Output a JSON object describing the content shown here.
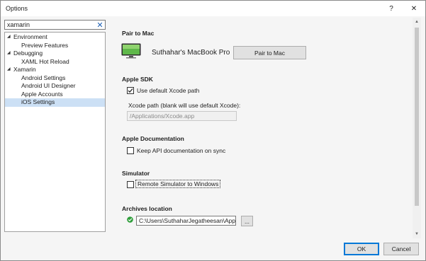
{
  "window": {
    "title": "Options",
    "help_label": "?",
    "close_label": "✕"
  },
  "search": {
    "value": "xamarin",
    "clear_label": "✕"
  },
  "tree": [
    {
      "label": "Environment",
      "expanded": true,
      "level": 0
    },
    {
      "label": "Preview Features",
      "level": 1
    },
    {
      "label": "Debugging",
      "expanded": true,
      "level": 0
    },
    {
      "label": "XAML Hot Reload",
      "level": 1
    },
    {
      "label": "Xamarin",
      "expanded": true,
      "level": 0
    },
    {
      "label": "Android Settings",
      "level": 1
    },
    {
      "label": "Android UI Designer",
      "level": 1
    },
    {
      "label": "Apple Accounts",
      "level": 1
    },
    {
      "label": "iOS Settings",
      "level": 1,
      "selected": true
    }
  ],
  "pair": {
    "title": "Pair to Mac",
    "mac_name": "Suthahar's MacBook Pro",
    "button_label": "Pair to Mac"
  },
  "sdk": {
    "title": "Apple SDK",
    "use_default_label": "Use default Xcode path",
    "use_default_checked": true,
    "xcode_path_label": "Xcode path (blank will use default Xcode):",
    "xcode_path_value": "/Applications/Xcode.app"
  },
  "docs": {
    "title": "Apple Documentation",
    "keep_label": "Keep API documentation on sync",
    "keep_checked": false
  },
  "simulator": {
    "title": "Simulator",
    "remote_label": "Remote Simulator to Windows",
    "remote_checked": false
  },
  "archives": {
    "title": "Archives location",
    "path_value": "C:\\Users\\SuthaharJegatheesan\\AppData\\",
    "browse_label": "..."
  },
  "footer": {
    "ok_label": "OK",
    "cancel_label": "Cancel"
  },
  "colors": {
    "selection": "#cce0f5",
    "ok_border": "#0078d7",
    "valid_green": "#2e9e3a"
  }
}
